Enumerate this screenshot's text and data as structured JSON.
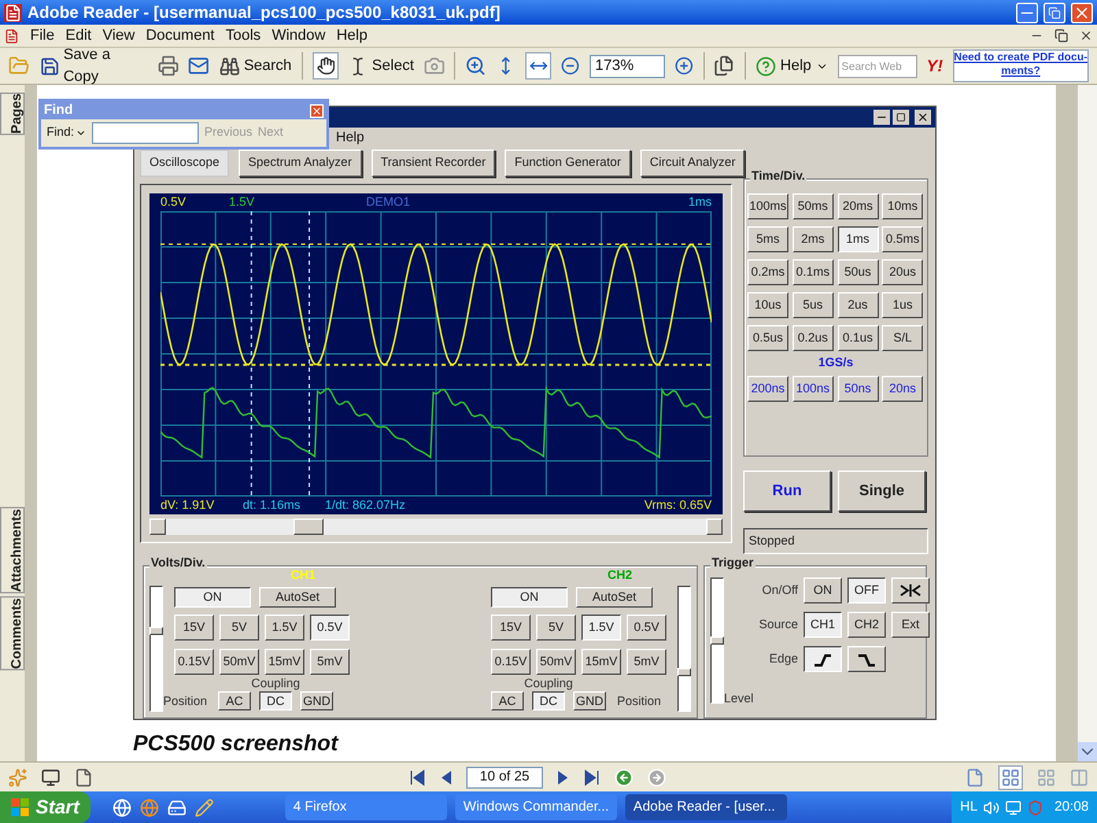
{
  "window": {
    "title": "Adobe Reader - [usermanual_pcs100_pcs500_k8031_uk.pdf]"
  },
  "menu": [
    "File",
    "Edit",
    "View",
    "Document",
    "Tools",
    "Window",
    "Help"
  ],
  "toolbar": {
    "save": "Save a Copy",
    "search": "Search",
    "select": "Select",
    "zoom": "173%",
    "help": "Help",
    "search_web_placeholder": "Search Web",
    "yahoo": "Y!",
    "ad_lines": [
      "Need to create PDF docu-",
      "ments?"
    ]
  },
  "side_tabs": [
    "Pages",
    "Attachments",
    "Comments"
  ],
  "find": {
    "title": "Find",
    "label": "Find:",
    "previous": "Previous",
    "next": "Next"
  },
  "app": {
    "menu": "Help",
    "tabs": [
      {
        "label": "Oscilloscope",
        "selected": true
      },
      {
        "label": "Spectrum Analyzer",
        "selected": false
      },
      {
        "label": "Transient Recorder",
        "selected": false
      },
      {
        "label": "Function Generator",
        "selected": false
      },
      {
        "label": "Circuit Analyzer",
        "selected": false
      }
    ],
    "scope": {
      "ch1": "0.5V",
      "ch2": "1.5V",
      "name": "DEMO1",
      "time": "1ms",
      "readouts": [
        "dV: 1.91V",
        "dt: 1.16ms",
        "1/dt: 862.07Hz"
      ],
      "vrms": "Vrms: 0.65V"
    },
    "time_div": {
      "title": "Time/Div.",
      "buttons": [
        {
          "label": "100ms",
          "selected": false
        },
        {
          "label": "50ms",
          "selected": false
        },
        {
          "label": "20ms",
          "selected": false
        },
        {
          "label": "10ms",
          "selected": false
        },
        {
          "label": "5ms",
          "selected": false
        },
        {
          "label": "2ms",
          "selected": false
        },
        {
          "label": "1ms",
          "selected": true
        },
        {
          "label": "0.5ms",
          "selected": false
        },
        {
          "label": "0.2ms",
          "selected": false
        },
        {
          "label": "0.1ms",
          "selected": false
        },
        {
          "label": "50us",
          "selected": false
        },
        {
          "label": "20us",
          "selected": false
        },
        {
          "label": "10us",
          "selected": false
        },
        {
          "label": "5us",
          "selected": false
        },
        {
          "label": "2us",
          "selected": false
        },
        {
          "label": "1us",
          "selected": false
        },
        {
          "label": "0.5us",
          "selected": false
        },
        {
          "label": "0.2us",
          "selected": false
        },
        {
          "label": "0.1us",
          "selected": false
        },
        {
          "label": "S/L",
          "selected": false
        }
      ],
      "fast_label": "1GS/s",
      "fast_buttons": [
        {
          "label": "200ns",
          "selected": false
        },
        {
          "label": "100ns",
          "selected": false
        },
        {
          "label": "50ns",
          "selected": false
        },
        {
          "label": "20ns",
          "selected": false
        }
      ]
    },
    "run": "Run",
    "single": "Single",
    "status": "Stopped",
    "volts": {
      "title": "Volts/Div.",
      "channels": [
        {
          "name": "CH1",
          "color": "#ffff00",
          "on_label": "ON",
          "on": true,
          "autoset": "AutoSet",
          "level": 0.65,
          "ranges": [
            {
              "label": "15V",
              "selected": false
            },
            {
              "label": "5V",
              "selected": false
            },
            {
              "label": "1.5V",
              "selected": false
            },
            {
              "label": "0.5V",
              "selected": true
            },
            {
              "label": "0.15V",
              "selected": false
            },
            {
              "label": "50mV",
              "selected": false
            },
            {
              "label": "15mV",
              "selected": false
            },
            {
              "label": "5mV",
              "selected": false
            }
          ],
          "coupling_label": "Coupling",
          "coupling": [
            {
              "label": "AC",
              "selected": false
            },
            {
              "label": "DC",
              "selected": true
            },
            {
              "label": "GND",
              "selected": false
            }
          ],
          "position": "Position"
        },
        {
          "name": "CH2",
          "color": "#00a800",
          "on_label": "ON",
          "on": true,
          "autoset": "AutoSet",
          "level": 0.3,
          "ranges": [
            {
              "label": "15V",
              "selected": false
            },
            {
              "label": "5V",
              "selected": false
            },
            {
              "label": "1.5V",
              "selected": true
            },
            {
              "label": "0.5V",
              "selected": false
            },
            {
              "label": "0.15V",
              "selected": false
            },
            {
              "label": "50mV",
              "selected": false
            },
            {
              "label": "15mV",
              "selected": false
            },
            {
              "label": "5mV",
              "selected": false
            }
          ],
          "coupling_label": "Coupling",
          "coupling": [
            {
              "label": "AC",
              "selected": false
            },
            {
              "label": "DC",
              "selected": true
            },
            {
              "label": "GND",
              "selected": false
            }
          ],
          "position": "Position"
        }
      ]
    },
    "trigger": {
      "title": "Trigger",
      "level": 0.5,
      "onoff_label": "On/Off",
      "onoff": [
        {
          "label": "ON",
          "selected": false
        },
        {
          "label": "OFF",
          "selected": true
        }
      ],
      "source_label": "Source",
      "sources": [
        {
          "label": "CH1",
          "selected": true
        },
        {
          "label": "CH2",
          "selected": false
        },
        {
          "label": "Ext",
          "selected": false
        }
      ],
      "edge_label": "Edge",
      "edges": [
        {
          "kind": "rising",
          "selected": true
        },
        {
          "kind": "falling",
          "selected": false
        }
      ],
      "level_label": "Level"
    }
  },
  "caption": "PCS500 screenshot",
  "page": {
    "current": "10 of 25"
  },
  "taskbar": {
    "start": "Start",
    "tasks": [
      {
        "label": "4 Firefox",
        "selected": false
      },
      {
        "label": "Windows Commander...",
        "selected": false
      },
      {
        "label": "Adobe Reader - [user...",
        "selected": true
      }
    ],
    "lang": "HL",
    "clock": "20:08"
  }
}
